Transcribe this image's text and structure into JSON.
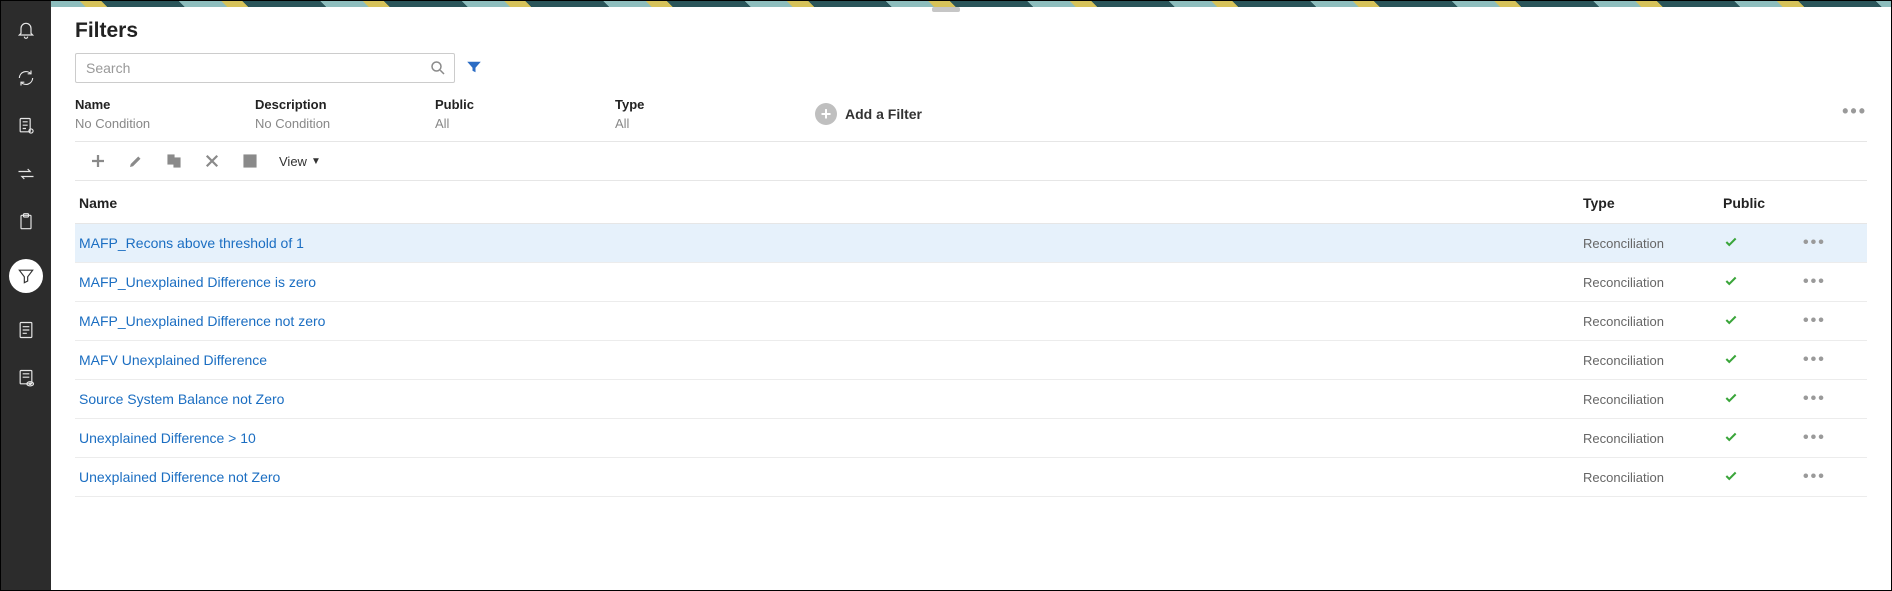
{
  "page": {
    "title": "Filters"
  },
  "search": {
    "placeholder": "Search"
  },
  "filterColumns": [
    {
      "label": "Name",
      "value": "No Condition"
    },
    {
      "label": "Description",
      "value": "No Condition"
    },
    {
      "label": "Public",
      "value": "All"
    },
    {
      "label": "Type",
      "value": "All"
    }
  ],
  "addFilter": {
    "label": "Add a Filter"
  },
  "toolbar": {
    "view": "View"
  },
  "grid": {
    "headers": {
      "name": "Name",
      "type": "Type",
      "public": "Public"
    },
    "rows": [
      {
        "name": "MAFP_Recons above threshold of 1",
        "type": "Reconciliation",
        "public": true,
        "selected": true
      },
      {
        "name": "MAFP_Unexplained Difference is zero",
        "type": "Reconciliation",
        "public": true,
        "selected": false
      },
      {
        "name": "MAFP_Unexplained Difference not zero",
        "type": "Reconciliation",
        "public": true,
        "selected": false
      },
      {
        "name": "MAFV Unexplained Difference",
        "type": "Reconciliation",
        "public": true,
        "selected": false
      },
      {
        "name": "Source System Balance not Zero",
        "type": "Reconciliation",
        "public": true,
        "selected": false
      },
      {
        "name": "Unexplained Difference > 10",
        "type": "Reconciliation",
        "public": true,
        "selected": false
      },
      {
        "name": "Unexplained Difference not Zero",
        "type": "Reconciliation",
        "public": true,
        "selected": false
      }
    ]
  }
}
